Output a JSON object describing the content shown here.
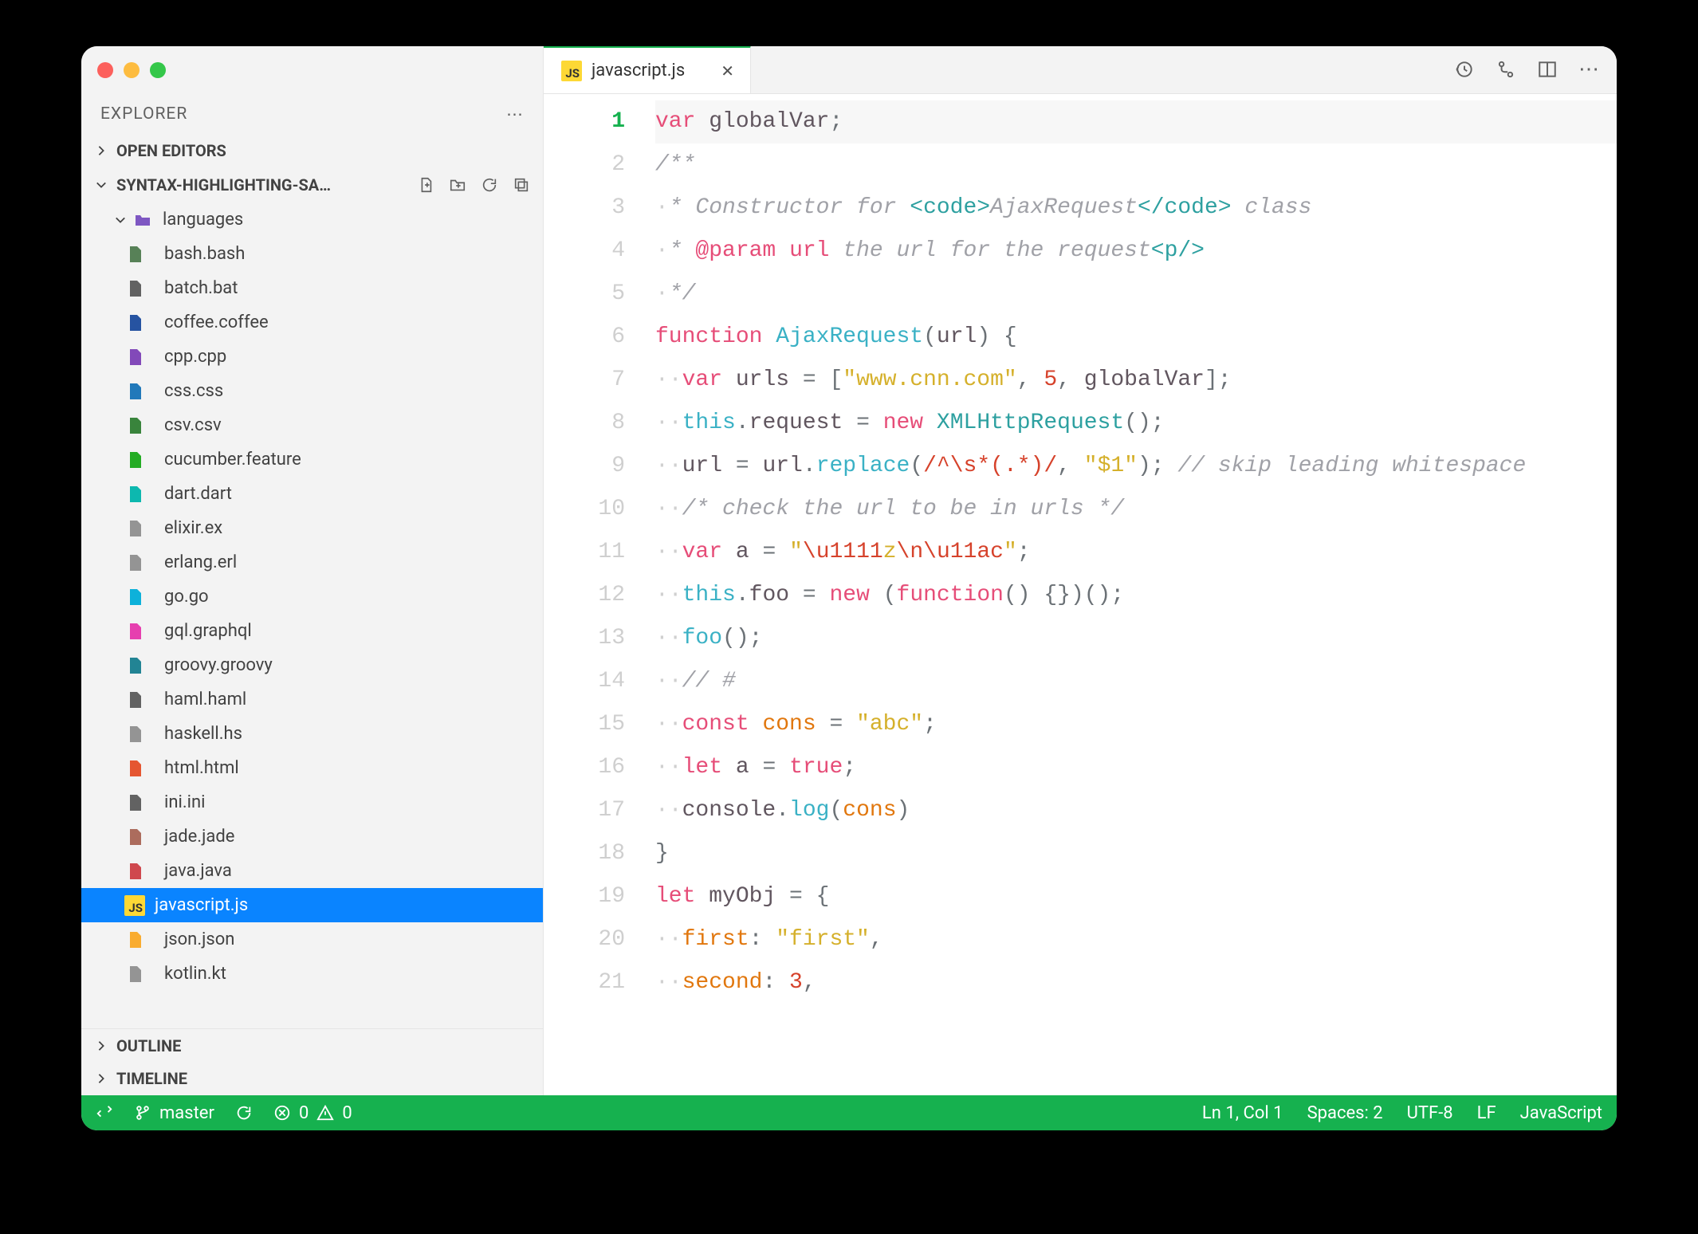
{
  "sidebar": {
    "header": "EXPLORER",
    "open_editors": "OPEN EDITORS",
    "project_label": "SYNTAX-HIGHLIGHTING-SA…",
    "folder": "languages",
    "outline": "OUTLINE",
    "timeline": "TIMELINE",
    "files": [
      {
        "name": "bash.bash",
        "clr": "#4e7a4e"
      },
      {
        "name": "batch.bat",
        "clr": "#5a5a5a"
      },
      {
        "name": "coffee.coffee",
        "clr": "#1a4a9c"
      },
      {
        "name": "cpp.cpp",
        "clr": "#7b3fb5"
      },
      {
        "name": "css.css",
        "clr": "#1572b6"
      },
      {
        "name": "csv.csv",
        "clr": "#2e7d32"
      },
      {
        "name": "cucumber.feature",
        "clr": "#18a818"
      },
      {
        "name": "dart.dart",
        "clr": "#00b4ab"
      },
      {
        "name": "elixir.ex",
        "clr": "#8e8e8e"
      },
      {
        "name": "erlang.erl",
        "clr": "#8e8e8e"
      },
      {
        "name": "go.go",
        "clr": "#00add8"
      },
      {
        "name": "gql.graphql",
        "clr": "#e535ab"
      },
      {
        "name": "groovy.groovy",
        "clr": "#167d8e"
      },
      {
        "name": "haml.haml",
        "clr": "#5a5a5a"
      },
      {
        "name": "haskell.hs",
        "clr": "#8e8e8e"
      },
      {
        "name": "html.html",
        "clr": "#e44d26"
      },
      {
        "name": "ini.ini",
        "clr": "#5a5a5a"
      },
      {
        "name": "jade.jade",
        "clr": "#a86454"
      },
      {
        "name": "java.java",
        "clr": "#cc3e44"
      },
      {
        "name": "javascript.js",
        "clr": "#fdd835",
        "selected": true,
        "js": true
      },
      {
        "name": "json.json",
        "clr": "#f9a825"
      },
      {
        "name": "kotlin.kt",
        "clr": "#8e8e8e"
      }
    ]
  },
  "tab": {
    "label": "javascript.js"
  },
  "code_lines": [
    {
      "n": 1,
      "active": true,
      "hl": true,
      "html": "<span class='kw'>var</span> <span class='id'>globalVar</span>;"
    },
    {
      "n": 2,
      "html": "<span class='cmt'>/**</span>"
    },
    {
      "n": 3,
      "html": "<span class='ws'>·</span><span class='cmt'>* Constructor for </span><span class='doctag'>&lt;code&gt;</span><span class='cmt'>AjaxRequest</span><span class='doctag'>&lt;/code&gt;</span><span class='cmt'> class</span>"
    },
    {
      "n": 4,
      "html": "<span class='ws'>·</span><span class='cmt'>* </span><span class='dockw'>@param</span> <span class='kw'>url</span> <span class='cmt'>the url for the request</span><span class='doctag'>&lt;p/&gt;</span>"
    },
    {
      "n": 5,
      "html": "<span class='ws'>·</span><span class='cmt'>*/</span>"
    },
    {
      "n": 6,
      "html": "<span class='kw'>function</span> <span class='fn'>AjaxRequest</span>(<span class='id'>url</span>) {"
    },
    {
      "n": 7,
      "html": "<span class='ws'>··</span><span class='kw'>var</span> <span class='id'>urls</span> = [<span class='str'>\"www.cnn.com\"</span>, <span class='num'>5</span>, <span class='id'>globalVar</span>];"
    },
    {
      "n": 8,
      "html": "<span class='ws'>··</span><span class='ths'>this</span>.<span class='id'>request</span> = <span class='kw'>new</span> <span class='cls'>XMLHttpRequest</span>();"
    },
    {
      "n": 9,
      "html": "<span class='ws'>··</span><span class='id'>url</span> = <span class='id'>url</span>.<span class='fn'>replace</span>(<span class='num'>/^\\s*(.*)/</span>, <span class='str'>\"$1\"</span>); <span class='cmt'>// skip leading whitespace</span>"
    },
    {
      "n": 10,
      "html": "<span class='ws'>··</span><span class='cmt'>/* check the url to be in urls */</span>"
    },
    {
      "n": 11,
      "html": "<span class='ws'>··</span><span class='kw'>var</span> <span class='id'>a</span> = <span class='str'>\"</span><span class='num'>\\u1111</span><span class='str'>z</span><span class='num'>\\n\\u11ac</span><span class='str'>\"</span>;"
    },
    {
      "n": 12,
      "html": "<span class='ws'>··</span><span class='ths'>this</span>.<span class='id'>foo</span> = <span class='kw'>new</span> (<span class='kw'>function</span>() {})();"
    },
    {
      "n": 13,
      "html": "<span class='ws'>··</span><span class='fn'>foo</span>();"
    },
    {
      "n": 14,
      "html": "<span class='ws'>··</span><span class='cmt'>// #</span>"
    },
    {
      "n": 15,
      "html": "<span class='ws'>··</span><span class='kw'>const</span> <span class='cns'>cons</span> = <span class='str'>\"abc\"</span>;"
    },
    {
      "n": 16,
      "html": "<span class='ws'>··</span><span class='kw'>let</span> <span class='id'>a</span> = <span class='kw'>true</span>;"
    },
    {
      "n": 17,
      "html": "<span class='ws'>··</span><span class='id'>console</span>.<span class='fn'>log</span>(<span class='cns'>cons</span>)"
    },
    {
      "n": 18,
      "html": "}"
    },
    {
      "n": 19,
      "html": "<span class='kw'>let</span> <span class='id'>myObj</span> = {"
    },
    {
      "n": 20,
      "html": "<span class='ws'>··</span><span class='cns'>first</span>: <span class='str'>\"first\"</span>,"
    },
    {
      "n": 21,
      "html": "<span class='ws'>··</span><span class='cns'>second</span>: <span class='num'>3</span>,"
    }
  ],
  "status": {
    "branch": "master",
    "errors": "0",
    "warnings": "0",
    "ln_col": "Ln 1, Col 1",
    "spaces": "Spaces: 2",
    "encoding": "UTF-8",
    "eol": "LF",
    "lang": "JavaScript"
  }
}
